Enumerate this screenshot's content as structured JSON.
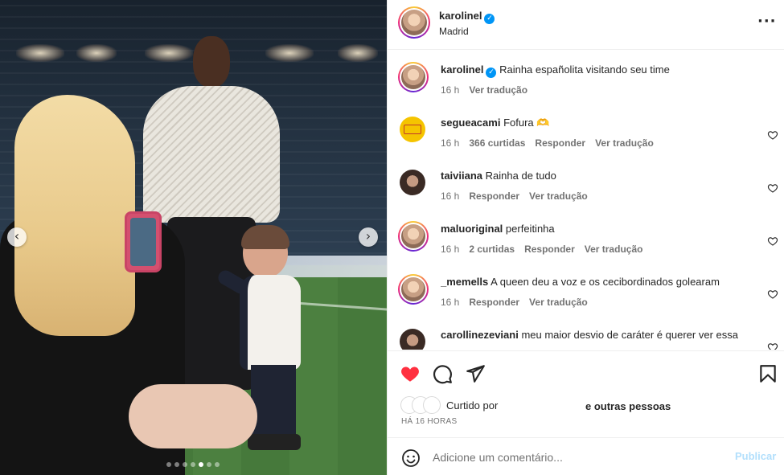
{
  "post": {
    "author": "karolinel",
    "verified": true,
    "location": "Madrid",
    "more_icon": "more-horizontal-icon"
  },
  "media": {
    "prev_icon": "chevron-left-icon",
    "next_icon": "chevron-right-icon",
    "prev_glyph": "‹",
    "next_glyph": "›",
    "slide_count": 7,
    "active_slide": 5
  },
  "caption": {
    "user": "karolinel",
    "text": "Rainha españolita visitando seu time",
    "time": "16 h",
    "translate": "Ver tradução"
  },
  "comments": [
    {
      "user": "segueacami",
      "text": "Fofura 🫶",
      "time": "16 h",
      "likes": "366 curtidas",
      "reply": "Responder",
      "translate": "Ver tradução",
      "avatar_style": "logo"
    },
    {
      "user": "taiviiana",
      "text": "Rainha de tudo",
      "time": "16 h",
      "likes": "",
      "reply": "Responder",
      "translate": "Ver tradução",
      "avatar_style": "plain"
    },
    {
      "user": "maluoriginal",
      "text": "perfeitinha",
      "time": "16 h",
      "likes": "2 curtidas",
      "reply": "Responder",
      "translate": "Ver tradução",
      "avatar_style": "ring"
    },
    {
      "user": "_memells",
      "text": "A queen deu a voz e os cecibordinados golearam",
      "time": "16 h",
      "likes": "",
      "reply": "Responder",
      "translate": "Ver tradução",
      "avatar_style": "ring"
    },
    {
      "user": "carollinezeviani",
      "text": "meu maior desvio de caráter é querer ver essa",
      "time": "",
      "likes": "",
      "reply": "",
      "translate": "",
      "avatar_style": "plain"
    }
  ],
  "actions": {
    "like_icon": "heart-filled-icon",
    "comment_icon": "comment-icon",
    "share_icon": "share-icon",
    "save_icon": "bookmark-icon",
    "liked_by": "Curtido por",
    "others": "e outras pessoas",
    "timestamp": "HÁ 16 HORAS"
  },
  "composer": {
    "placeholder": "Adicione um comentário...",
    "publish": "Publicar",
    "emoji_icon": "emoji-icon"
  },
  "colors": {
    "like_red": "#ff3040",
    "verified_blue": "#0095f6",
    "publish_disabled": "#b2dffc",
    "meta_gray": "#737373"
  }
}
